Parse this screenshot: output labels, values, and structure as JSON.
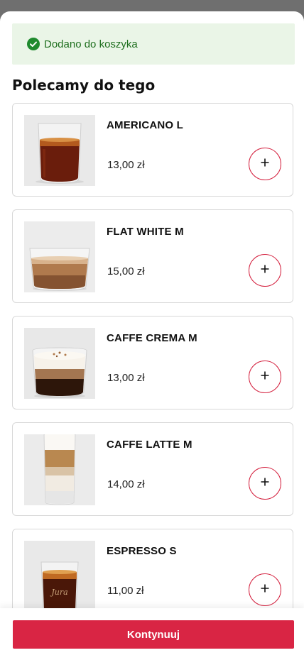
{
  "notification": {
    "text": "Dodano do koszyka",
    "icon": "check-circle-icon",
    "color": "#1f6f1f"
  },
  "section": {
    "title": "Polecamy do tego"
  },
  "products": [
    {
      "name": "AMERICANO L",
      "price": "13,00 zł",
      "image": "americano-glass"
    },
    {
      "name": "FLAT WHITE M",
      "price": "15,00 zł",
      "image": "flat-white-glass"
    },
    {
      "name": "CAFFE CREMA M",
      "price": "13,00 zł",
      "image": "caffe-crema-glass"
    },
    {
      "name": "CAFFE LATTE M",
      "price": "14,00 zł",
      "image": "caffe-latte-glass"
    },
    {
      "name": "ESPRESSO S",
      "price": "11,00 zł",
      "image": "espresso-glass"
    }
  ],
  "add_button": {
    "icon": "plus-icon"
  },
  "footer": {
    "continue_label": "Kontynuuj"
  },
  "colors": {
    "accent": "#d92544",
    "toast_bg": "#eaf5e7"
  }
}
